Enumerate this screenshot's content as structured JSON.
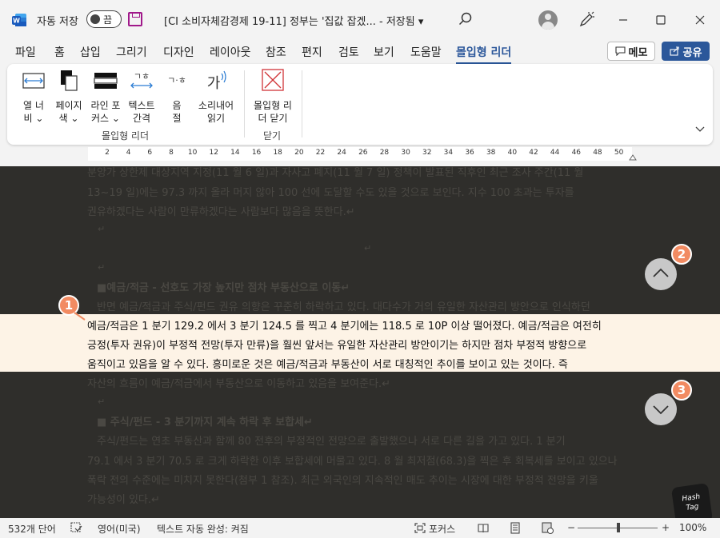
{
  "titlebar": {
    "autosave_label": "자동 저장",
    "autosave_state": "끔",
    "doc_title": "[CI 소비자체감경제 19-11] 정부는 '집값 잡겠...",
    "save_status": "- 저장됨 ▾"
  },
  "tabs": [
    "파일",
    "홈",
    "삽입",
    "그리기",
    "디자인",
    "레이아웃",
    "참조",
    "편지",
    "검토",
    "보기",
    "도움말",
    "몰입형 리더"
  ],
  "active_tab": "몰입형 리더",
  "buttons": {
    "memo": "메모",
    "share": "공유"
  },
  "ribbon": {
    "buttons": [
      {
        "line1": "열 너",
        "line2": "비 ⌄"
      },
      {
        "line1": "페이지",
        "line2": "색 ⌄"
      },
      {
        "line1": "라인 포",
        "line2": "커스 ⌄"
      },
      {
        "line1": "텍스트",
        "line2": "간격"
      },
      {
        "line1": "음",
        "line2": "절"
      },
      {
        "line1": "소리내어",
        "line2": "읽기"
      },
      {
        "line1": "몰입형 리",
        "line2": "더 닫기"
      }
    ],
    "icon_text": {
      "syllable": "ㄱ·ㅎ",
      "spacing": "ㄱㅎ",
      "read_aloud": "가"
    },
    "groups": [
      "몰입형 리더",
      "닫기"
    ]
  },
  "ruler_ticks": [
    "2",
    "4",
    "6",
    "8",
    "10",
    "12",
    "14",
    "16",
    "18",
    "20",
    "22",
    "24",
    "26",
    "28",
    "30",
    "32",
    "34",
    "36",
    "38",
    "40",
    "42",
    "44",
    "46",
    "48",
    "50"
  ],
  "document": {
    "lines_top": [
      "분양가 상한제 대상지역 지정(11 월 6 일)과 자사고 폐지(11 월 7 일) 정책이 발표된 직후인 최근 조사 주간(11 월",
      "13~19 일)에는 97.3 까지 올라 머지 않아 100 선에 도달할 수도 있을 것으로 보인다. 지수 100 초과는 투자를",
      "권유하겠다는 사람이 만류하겠다는 사람보다 많음을 뜻한다.↵"
    ],
    "heading1": "■예금/적금 - 선호도 가장 높지만 점차 부동산으로 이동↵",
    "line_before_focus": "반면 예금/적금과 주식/펀드 권유 의향은 꾸준히 하락하고 있다. 대다수가 거의 유일한 자산관리 방안으로 인식하던",
    "focus_lines": [
      "예금/적금은 1 분기 129.2 에서 3 분기 124.5 를 찍고 4 분기에는 118.5 로 10P 이상 떨어졌다. 예금/적금은 여전히",
      "긍정(투자 권유)이 부정적 전망(투자 만류)을 훨씬 앞서는 유일한 자산관리 방안이기는 하지만 점차 부정적 방향으로",
      "움직이고 있음을 알 수 있다. 흥미로운 것은 예금/적금과 부동산이 서로 대칭적인 추이를 보이고 있는 것이다. 즉"
    ],
    "line_after_focus": "자산의 흐름이 예금/적금에서 부동산으로 이동하고 있음을 보여준다.↵",
    "heading2": "■ 주식/펀드 - 3 분기까지 계속 하락 후 보합세↵",
    "lines_bottom": [
      "주식/펀드는 연초 부동산과 함께 80 전후의 부정적인 전망으로 출발했으나 서로 다른 길을 가고 있다. 1 분기",
      "79.1 에서 3 분기 70.5 로 크게 하락한 이후 보합세에 머물고 있다. 8 월 최저점(68.3)을 찍은 후 회복세를 보이고 있으나",
      "폭락 전의 수준에는 미치지 못한다(첨부 1 참조). 최근 외국인의 지속적인 매도 추이는 시장에 대한 부정적 전망을 키울",
      "가능성이 있다.↵"
    ],
    "para_mark": "↵"
  },
  "annotations": {
    "focus": "1",
    "up": "2",
    "down": "3"
  },
  "watermark": {
    "line1": "Hash",
    "line2": "Tag"
  },
  "statusbar": {
    "words": "532개 단어",
    "language": "영어(미국)",
    "autocomplete": "텍스트 자동 완성: 켜짐",
    "focus": "포커스",
    "zoom_minus": "−",
    "zoom_plus": "+",
    "zoom": "100%"
  },
  "colors": {
    "accent": "#2b579a",
    "annotation": "#f28b62",
    "focus_band": "#fdf3e6",
    "dim_overlay": "#2f2e2b"
  }
}
